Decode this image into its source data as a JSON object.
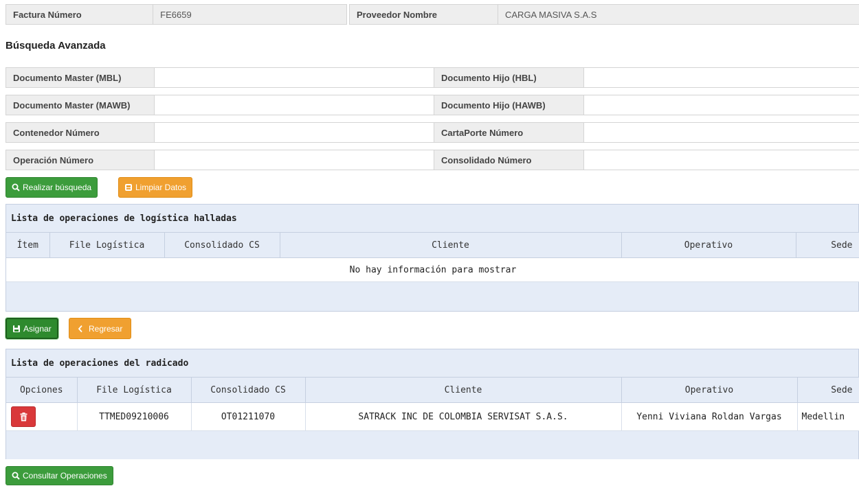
{
  "header": {
    "factura_label": "Factura Número",
    "factura_value": "FE6659",
    "proveedor_label": "Proveedor Nombre",
    "proveedor_value": "CARGA MASIVA S.A.S"
  },
  "search": {
    "title": "Búsqueda Avanzada",
    "fields": [
      {
        "label": "Documento Master (MBL)",
        "value": ""
      },
      {
        "label": "Documento Hijo (HBL)",
        "value": ""
      },
      {
        "label": "Documento Master (MAWB)",
        "value": ""
      },
      {
        "label": "Documento Hijo (HAWB)",
        "value": ""
      },
      {
        "label": "Contenedor Número",
        "value": ""
      },
      {
        "label": "CartaPorte Número",
        "value": ""
      },
      {
        "label": "Operación Número",
        "value": ""
      },
      {
        "label": "Consolidado Número",
        "value": ""
      }
    ],
    "search_button": "Realizar búsqueda",
    "clear_button": "Limpiar Datos"
  },
  "found_panel": {
    "title": "Lista de operaciones de logística halladas",
    "columns": [
      "Ítem",
      "File Logística",
      "Consolidado CS",
      "Cliente",
      "Operativo",
      "Sede"
    ],
    "empty_message": "No hay información para mostrar"
  },
  "actions": {
    "assign_button": "Asignar",
    "back_button": "Regresar"
  },
  "radicado_panel": {
    "title": "Lista de operaciones del radicado",
    "columns": [
      "Opciones",
      "File Logística",
      "Consolidado CS",
      "Cliente",
      "Operativo",
      "Sede"
    ],
    "rows": [
      {
        "file": "TTMED09210006",
        "consolidado": "OT01211070",
        "cliente": "SATRACK INC DE COLOMBIA SERVISAT S.A.S.",
        "operativo": "Yenni Viviana Roldan Vargas",
        "sede": "Medellin"
      }
    ]
  },
  "bottom": {
    "consult_button": "Consultar Operaciones"
  },
  "colors": {
    "green": "#3c9c3c",
    "orange": "#f0a030",
    "red": "#d9383a",
    "panel_blue": "#e5ecf7"
  },
  "icons": {
    "search": "search-icon",
    "clear": "eraser-icon",
    "save": "floppy-icon",
    "back": "chevron-left-icon",
    "delete": "trash-icon"
  }
}
